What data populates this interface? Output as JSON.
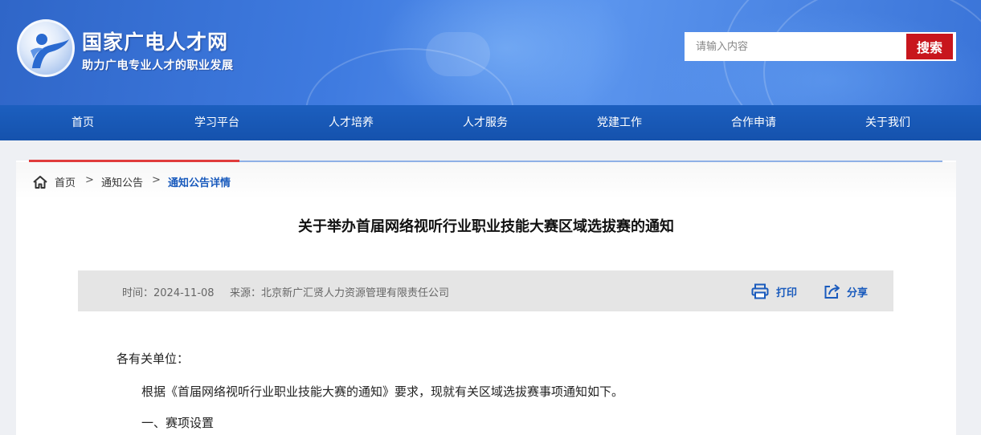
{
  "header": {
    "site_title": "国家广电人才网",
    "site_slogan": "助力广电专业人才的职业发展",
    "logo_icon": "site-logo-icon",
    "search": {
      "placeholder": "请输入内容",
      "button_label": "搜索"
    }
  },
  "nav": {
    "items": [
      {
        "label": "首页"
      },
      {
        "label": "学习平台"
      },
      {
        "label": "人才培养"
      },
      {
        "label": "人才服务"
      },
      {
        "label": "党建工作"
      },
      {
        "label": "合作申请"
      },
      {
        "label": "关于我们"
      }
    ]
  },
  "breadcrumb": {
    "icon": "home-icon",
    "items": [
      "首页",
      "通知公告",
      "通知公告详情"
    ],
    "separator": ">"
  },
  "article": {
    "title": "关于举办首届网络视听行业职业技能大赛区域选拔赛的通知",
    "meta": {
      "time": "时间：2024-11-08",
      "source": "来源：北京新广汇贤人力资源管理有限责任公司",
      "print_label": "打印",
      "share_label": "分享"
    },
    "body": {
      "salutation": "各有关单位：",
      "intro": "根据《首届网络视听行业职业技能大赛的通知》要求，现就有关区域选拔赛事项通知如下。",
      "section1": "一、赛项设置"
    }
  },
  "colors": {
    "nav_bg": "#1552ad",
    "search_button": "#c8161d",
    "accent_blue": "#1a5bbd",
    "accent_red": "#e03c3c"
  }
}
